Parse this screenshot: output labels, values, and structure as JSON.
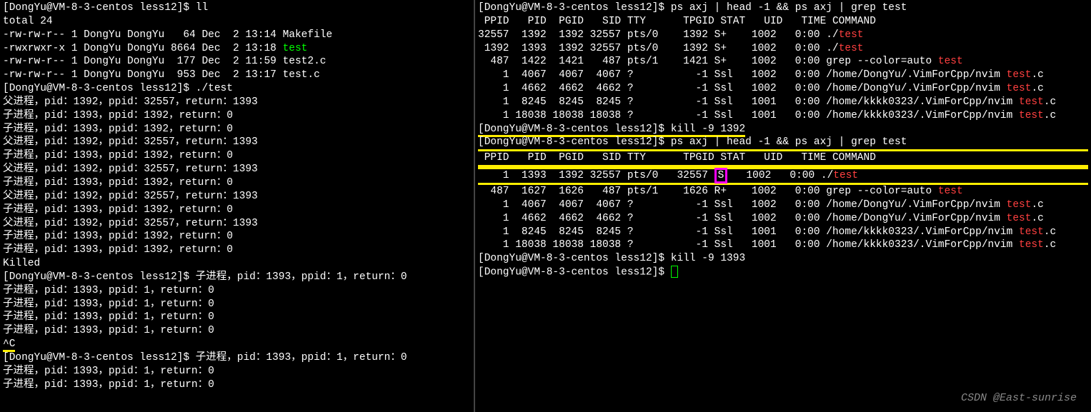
{
  "left": {
    "prompt1": "[DongYu@VM-8-3-centos less12]$ ll",
    "total": "total 24",
    "ls": [
      {
        "perm": "-rw-rw-r--",
        "n": "1",
        "u": "DongYu",
        "g": "DongYu",
        "sz": "  64",
        "date": "Dec  2 13:14",
        "name": "Makefile",
        "cls": ""
      },
      {
        "perm": "-rwxrwxr-x",
        "n": "1",
        "u": "DongYu",
        "g": "DongYu",
        "sz": "8664",
        "date": "Dec  2 13:18",
        "name": "test",
        "cls": "g"
      },
      {
        "perm": "-rw-rw-r--",
        "n": "1",
        "u": "DongYu",
        "g": "DongYu",
        "sz": " 177",
        "date": "Dec  2 11:59",
        "name": "test2.c",
        "cls": ""
      },
      {
        "perm": "-rw-rw-r--",
        "n": "1",
        "u": "DongYu",
        "g": "DongYu",
        "sz": " 953",
        "date": "Dec  2 13:17",
        "name": "test.c",
        "cls": ""
      }
    ],
    "prompt2": "[DongYu@VM-8-3-centos less12]$ ./test",
    "proc": [
      "父进程，pid：1392，ppid：32557，return：1393",
      "子进程，pid：1393，ppid：1392，return：0",
      "子进程，pid：1393，ppid：1392，return：0",
      "父进程，pid：1392，ppid：32557，return：1393",
      "子进程，pid：1393，ppid：1392，return：0",
      "父进程，pid：1392，ppid：32557，return：1393",
      "子进程，pid：1393，ppid：1392，return：0",
      "父进程，pid：1392，ppid：32557，return：1393",
      "子进程，pid：1393，ppid：1392，return：0",
      "父进程，pid：1392，ppid：32557，return：1393",
      "子进程，pid：1393，ppid：1392，return：0",
      "子进程，pid：1393，ppid：1392，return：0"
    ],
    "killed": "Killed",
    "prompt3": "[DongYu@VM-8-3-centos less12]$ 子进程，pid：1393，ppid：1，return：0",
    "orphan": [
      "子进程，pid：1393，ppid：1，return：0",
      "子进程，pid：1393，ppid：1，return：0",
      "子进程，pid：1393，ppid：1，return：0",
      "子进程，pid：1393，ppid：1，return：0"
    ],
    "ctrlc": "^C",
    "prompt4": "[DongYu@VM-8-3-centos less12]$ 子进程，pid：1393，ppid：1，return：0",
    "orphan2": [
      "子进程，pid：1393，ppid：1，return：0",
      "子进程，pid：1393，ppid：1，return：0"
    ]
  },
  "right": {
    "prompt1": "[DongYu@VM-8-3-centos less12]$ ps axj | head -1 && ps axj | grep test",
    "hdr": " PPID   PID  PGID   SID TTY      TPGID STAT   UID   TIME COMMAND",
    "ps1": [
      {
        "ppid": "32557",
        "pid": " 1392",
        "pgid": " 1392",
        "sid": "32557",
        "tty": "pts/0",
        "tpgid": "   1392",
        "stat": "S+ ",
        "uid": "  1002",
        "time": "  0:00",
        "pre": " ./",
        "cmd": "test",
        "post": ""
      },
      {
        "ppid": " 1392",
        "pid": " 1393",
        "pgid": " 1392",
        "sid": "32557",
        "tty": "pts/0",
        "tpgid": "   1392",
        "stat": "S+ ",
        "uid": "  1002",
        "time": "  0:00",
        "pre": " ./",
        "cmd": "test",
        "post": ""
      },
      {
        "ppid": "  487",
        "pid": " 1422",
        "pgid": " 1421",
        "sid": "  487",
        "tty": "pts/1",
        "tpgid": "   1421",
        "stat": "S+ ",
        "uid": "  1002",
        "time": "  0:00",
        "pre": " grep --color=auto ",
        "cmd": "test",
        "post": ""
      },
      {
        "ppid": "    1",
        "pid": " 4067",
        "pgid": " 4067",
        "sid": " 4067",
        "tty": "?    ",
        "tpgid": "     -1",
        "stat": "Ssl",
        "uid": "  1002",
        "time": "  0:00",
        "pre": " /home/DongYu/.VimForCpp/nvim ",
        "cmd": "test",
        "post": ".c"
      },
      {
        "ppid": "    1",
        "pid": " 4662",
        "pgid": " 4662",
        "sid": " 4662",
        "tty": "?    ",
        "tpgid": "     -1",
        "stat": "Ssl",
        "uid": "  1002",
        "time": "  0:00",
        "pre": " /home/DongYu/.VimForCpp/nvim ",
        "cmd": "test",
        "post": ".c"
      },
      {
        "ppid": "    1",
        "pid": " 8245",
        "pgid": " 8245",
        "sid": " 8245",
        "tty": "?    ",
        "tpgid": "     -1",
        "stat": "Ssl",
        "uid": "  1001",
        "time": "  0:00",
        "pre": " /home/kkkk0323/.VimForCpp/nvim ",
        "cmd": "test",
        "post": ".c"
      },
      {
        "ppid": "    1",
        "pid": "18038",
        "pgid": "18038",
        "sid": "18038",
        "tty": "?    ",
        "tpgid": "     -1",
        "stat": "Ssl",
        "uid": "  1001",
        "time": "  0:00",
        "pre": " /home/kkkk0323/.VimForCpp/nvim ",
        "cmd": "test",
        "post": ".c"
      }
    ],
    "prompt_kill1": "[DongYu@VM-8-3-centos less12]$ kill -9 1392",
    "prompt2": "[DongYu@VM-8-3-centos less12]$ ps axj | head -1 && ps axj | grep test",
    "hdr2": " PPID   PID  PGID   SID TTY      TPGID STAT   UID   TIME COMMAND",
    "ps2_first": {
      "ppid": "    1",
      "pid": " 1393",
      "pgid": " 1392",
      "sid": "32557",
      "tty": "pts/0",
      "tpgid": "  32557",
      "stat": "S",
      "uid": "  1002",
      "time": "  0:00",
      "pre": " ./",
      "cmd": "test",
      "post": ""
    },
    "ps2": [
      {
        "ppid": "  487",
        "pid": " 1627",
        "pgid": " 1626",
        "sid": "  487",
        "tty": "pts/1",
        "tpgid": "   1626",
        "stat": "R+ ",
        "uid": "  1002",
        "time": "  0:00",
        "pre": " grep --color=auto ",
        "cmd": "test",
        "post": ""
      },
      {
        "ppid": "    1",
        "pid": " 4067",
        "pgid": " 4067",
        "sid": " 4067",
        "tty": "?    ",
        "tpgid": "     -1",
        "stat": "Ssl",
        "uid": "  1002",
        "time": "  0:00",
        "pre": " /home/DongYu/.VimForCpp/nvim ",
        "cmd": "test",
        "post": ".c"
      },
      {
        "ppid": "    1",
        "pid": " 4662",
        "pgid": " 4662",
        "sid": " 4662",
        "tty": "?    ",
        "tpgid": "     -1",
        "stat": "Ssl",
        "uid": "  1002",
        "time": "  0:00",
        "pre": " /home/DongYu/.VimForCpp/nvim ",
        "cmd": "test",
        "post": ".c"
      },
      {
        "ppid": "    1",
        "pid": " 8245",
        "pgid": " 8245",
        "sid": " 8245",
        "tty": "?    ",
        "tpgid": "     -1",
        "stat": "Ssl",
        "uid": "  1001",
        "time": "  0:00",
        "pre": " /home/kkkk0323/.VimForCpp/nvim ",
        "cmd": "test",
        "post": ".c"
      },
      {
        "ppid": "    1",
        "pid": "18038",
        "pgid": "18038",
        "sid": "18038",
        "tty": "?    ",
        "tpgid": "     -1",
        "stat": "Ssl",
        "uid": "  1001",
        "time": "  0:00",
        "pre": " /home/kkkk0323/.VimForCpp/nvim ",
        "cmd": "test",
        "post": ".c"
      }
    ],
    "prompt_kill2": "[DongYu@VM-8-3-centos less12]$ kill -9 1393",
    "prompt3": "[DongYu@VM-8-3-centos less12]$ ",
    "watermark": "CSDN @East-sunrise"
  }
}
